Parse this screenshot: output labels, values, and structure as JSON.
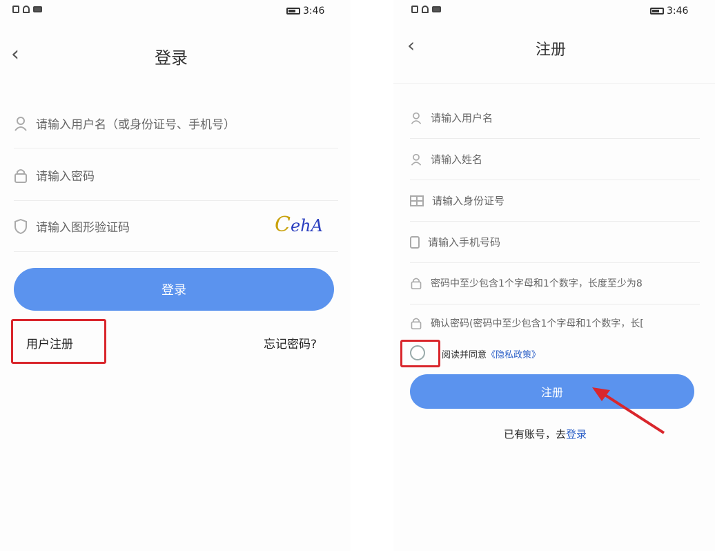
{
  "colors": {
    "primary_button": "#5b93ee",
    "highlight_box": "#d9262c",
    "arrow": "#d9262c",
    "link": "#2b5fc7"
  },
  "login": {
    "status": {
      "time": "3:46"
    },
    "title": "登录",
    "username_placeholder": "请输入用户名（或身份证号、手机号）",
    "password_placeholder": "请输入密码",
    "captcha_placeholder": "请输入图形验证码",
    "captcha_text": [
      "C",
      "e",
      "h",
      "A"
    ],
    "login_button": "登录",
    "register_link": "用户注册",
    "forgot_link": "忘记密码?"
  },
  "register": {
    "status": {
      "time": "3:46"
    },
    "title": "注册",
    "fields": [
      {
        "placeholder": "请输入用户名",
        "icon": "user-icon"
      },
      {
        "placeholder": "请输入姓名",
        "icon": "person-icon"
      },
      {
        "placeholder": "请输入身份证号",
        "icon": "id-card-icon"
      },
      {
        "placeholder": "请输入手机号码",
        "icon": "phone-icon"
      },
      {
        "placeholder": "密码中至少包含1个字母和1个数字，长度至少为8",
        "icon": "lock-icon"
      },
      {
        "placeholder": "确认密码(密码中至少包含1个字母和1个数字，长[",
        "icon": "lock-icon"
      }
    ],
    "agree_text": "阅读并同意",
    "privacy_link": "《隐私政策》",
    "register_button": "注册",
    "has_account_text": "已有账号，去",
    "login_link": "登录"
  }
}
